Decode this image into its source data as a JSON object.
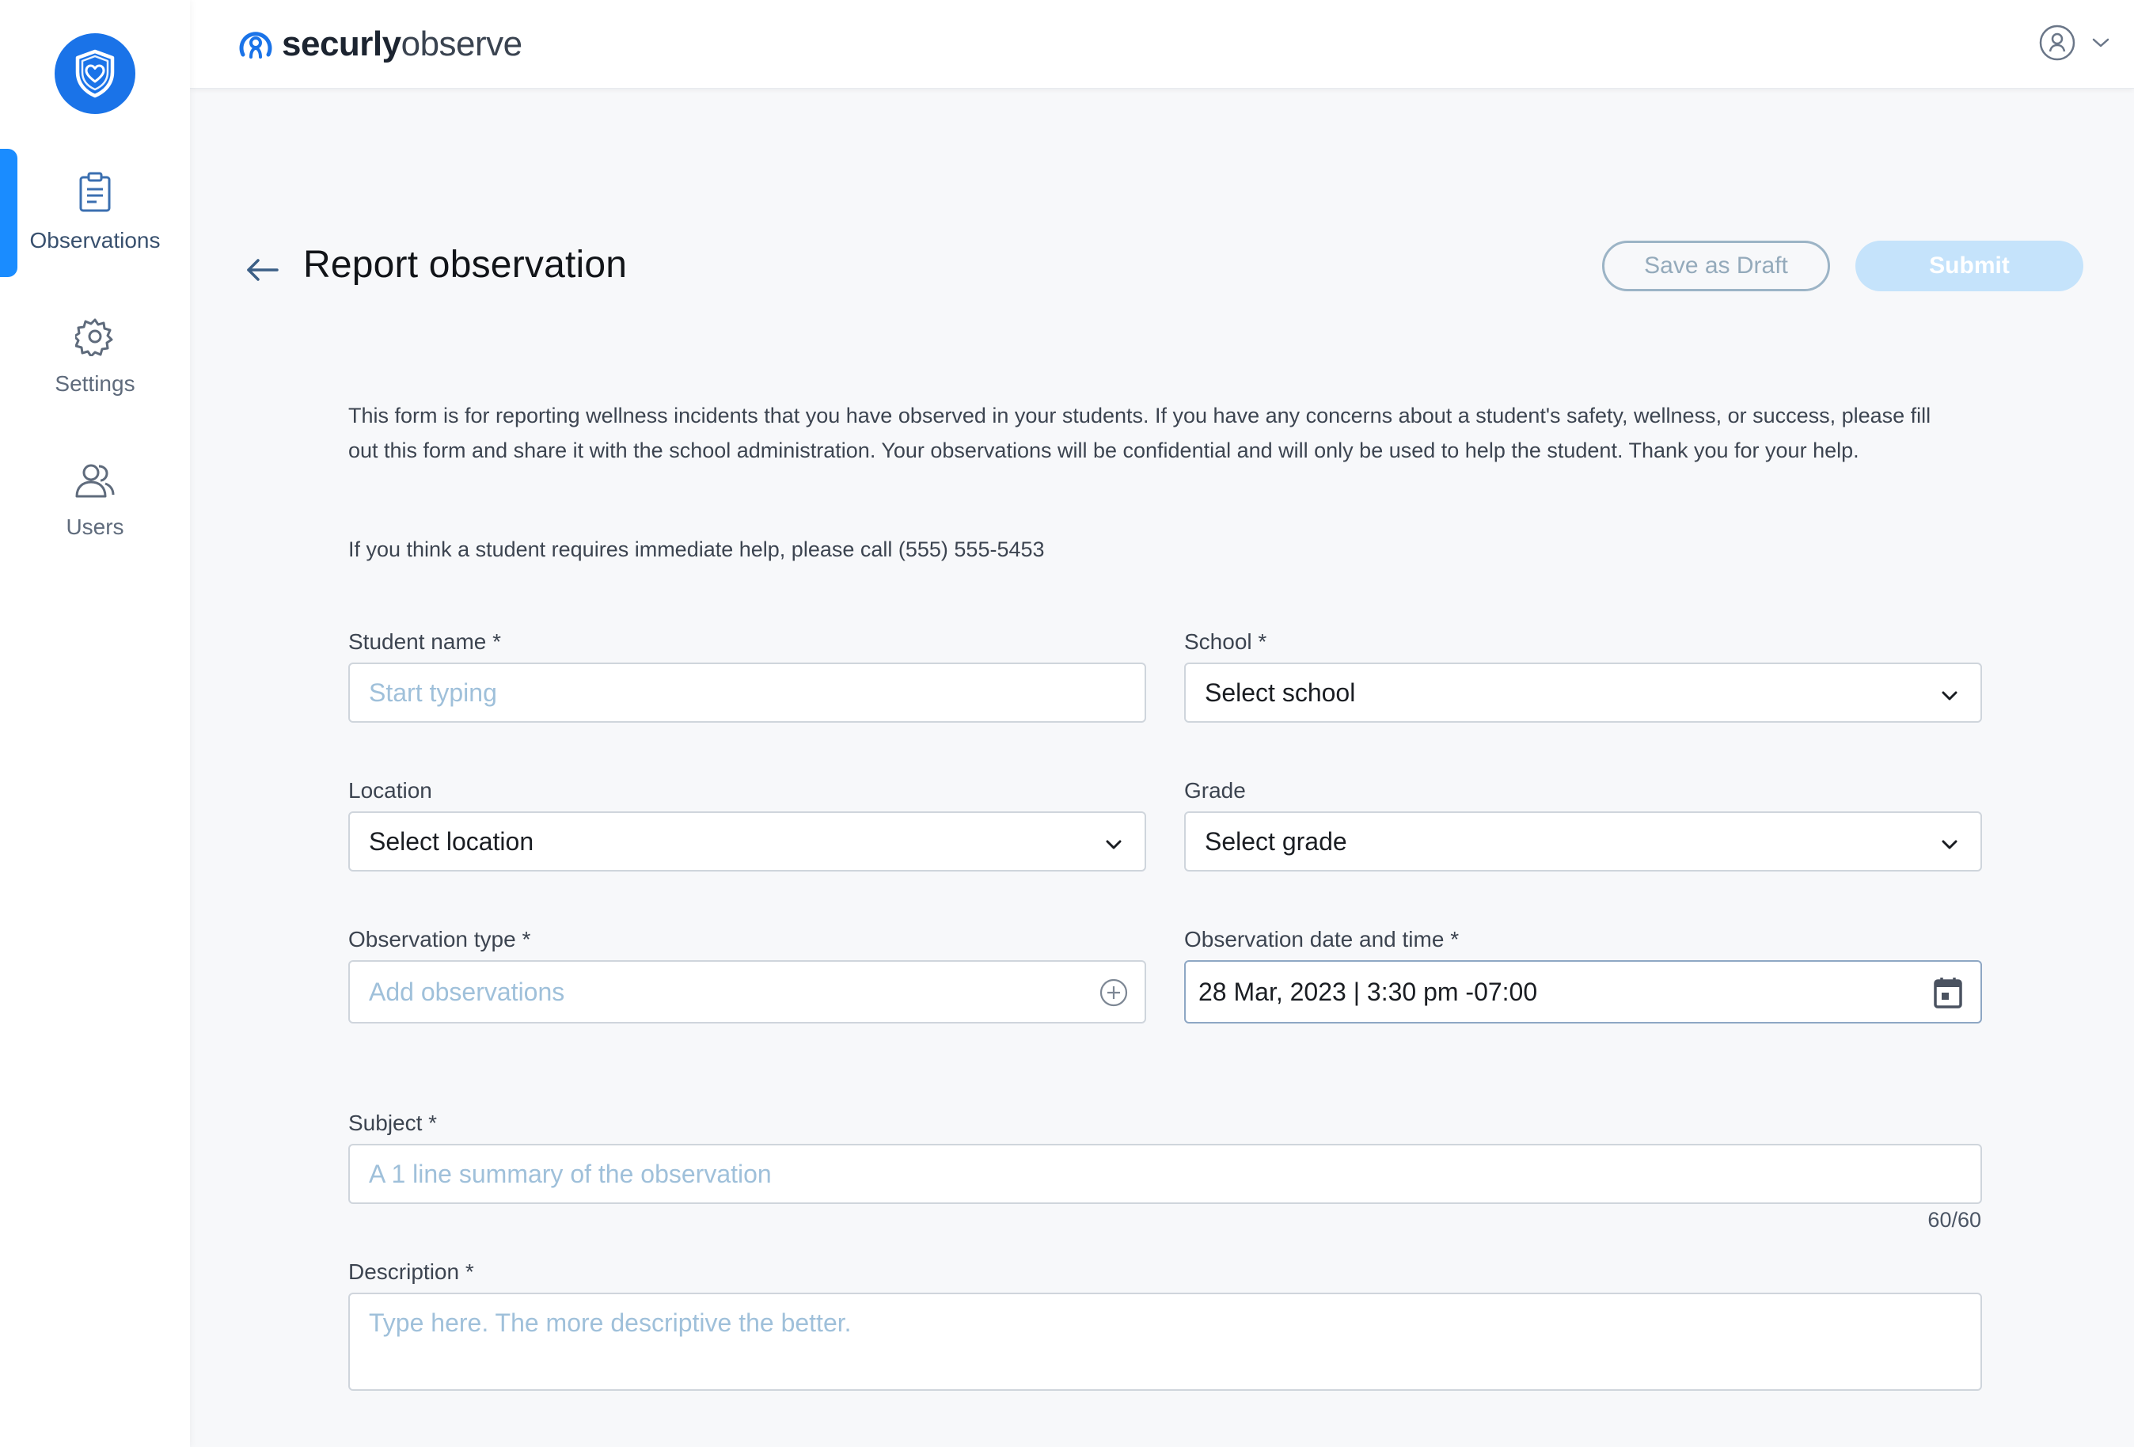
{
  "brand": {
    "name_bold": "securly",
    "name_light": "observe"
  },
  "sidebar": {
    "items": [
      {
        "label": "Observations",
        "icon": "clipboard-icon",
        "active": true
      },
      {
        "label": "Settings",
        "icon": "gear-icon",
        "active": false
      },
      {
        "label": "Users",
        "icon": "users-icon",
        "active": false
      }
    ]
  },
  "page": {
    "title": "Report observation",
    "save_draft_label": "Save as Draft",
    "submit_label": "Submit",
    "intro_text": "This form is for reporting wellness incidents that you have observed in your students. If you have any concerns about a student's safety, wellness, or success, please fill out this form and share it with the school administration. Your observations will be confidential and will only be used to help the student. Thank you for your help.",
    "help_text": "If you think a student requires immediate help, please call (555) 555-5453"
  },
  "form": {
    "student_name": {
      "label": "Student name *",
      "placeholder": "Start typing"
    },
    "school": {
      "label": "School *",
      "value": "Select school"
    },
    "location": {
      "label": "Location",
      "value": "Select location"
    },
    "grade": {
      "label": "Grade",
      "value": "Select grade"
    },
    "observation_type": {
      "label": "Observation type *",
      "placeholder": "Add observations"
    },
    "observation_datetime": {
      "label": "Observation date and time *",
      "value": "28 Mar, 2023 | 3:30 pm -07:00"
    },
    "subject": {
      "label": "Subject *",
      "placeholder": "A 1 line summary of the observation",
      "counter": "60/60"
    },
    "description": {
      "label": "Description *",
      "placeholder": "Type here. The more descriptive the better."
    }
  },
  "colors": {
    "accent": "#1a73e8",
    "active_bar": "#1a8cff",
    "placeholder": "#9fc0da",
    "submit_disabled": "#c5e3fb"
  }
}
